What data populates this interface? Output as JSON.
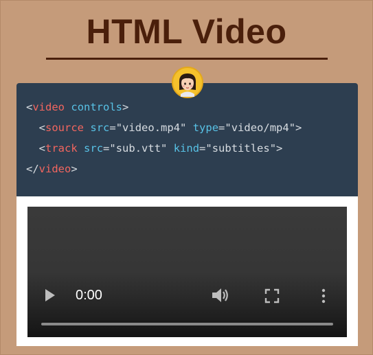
{
  "header": {
    "title": "HTML Video"
  },
  "avatar": {
    "icon": "woman-face-icon",
    "ring_color": "#f5c12c"
  },
  "code": {
    "lines": [
      {
        "indent": "",
        "open": "<",
        "tag": "video",
        "attr": "controls",
        "close": ">"
      },
      {
        "indent": "  ",
        "open": "<",
        "tag": "source",
        "attr1": "src",
        "val1": "\"video.mp4\"",
        "attr2": "type",
        "val2": "\"video/mp4\"",
        "close": ">"
      },
      {
        "indent": "  ",
        "open": "<",
        "tag": "track",
        "attr1": "src",
        "val1": "\"sub.vtt\"",
        "attr2": "kind",
        "val2": "\"subtitles\"",
        "close": ">"
      },
      {
        "indent": "",
        "open": "</",
        "tag": "video",
        "close": ">"
      }
    ]
  },
  "player": {
    "current_time": "0:00",
    "progress": 0,
    "controls": {
      "play": "play-icon",
      "volume": "volume-icon",
      "fullscreen": "fullscreen-icon",
      "more": "more-options-icon"
    }
  },
  "colors": {
    "background": "#c59b7a",
    "title": "#4a1f0b",
    "code_bg": "#2d3e50",
    "tag": "#f3665f",
    "attr": "#58c2e6"
  }
}
